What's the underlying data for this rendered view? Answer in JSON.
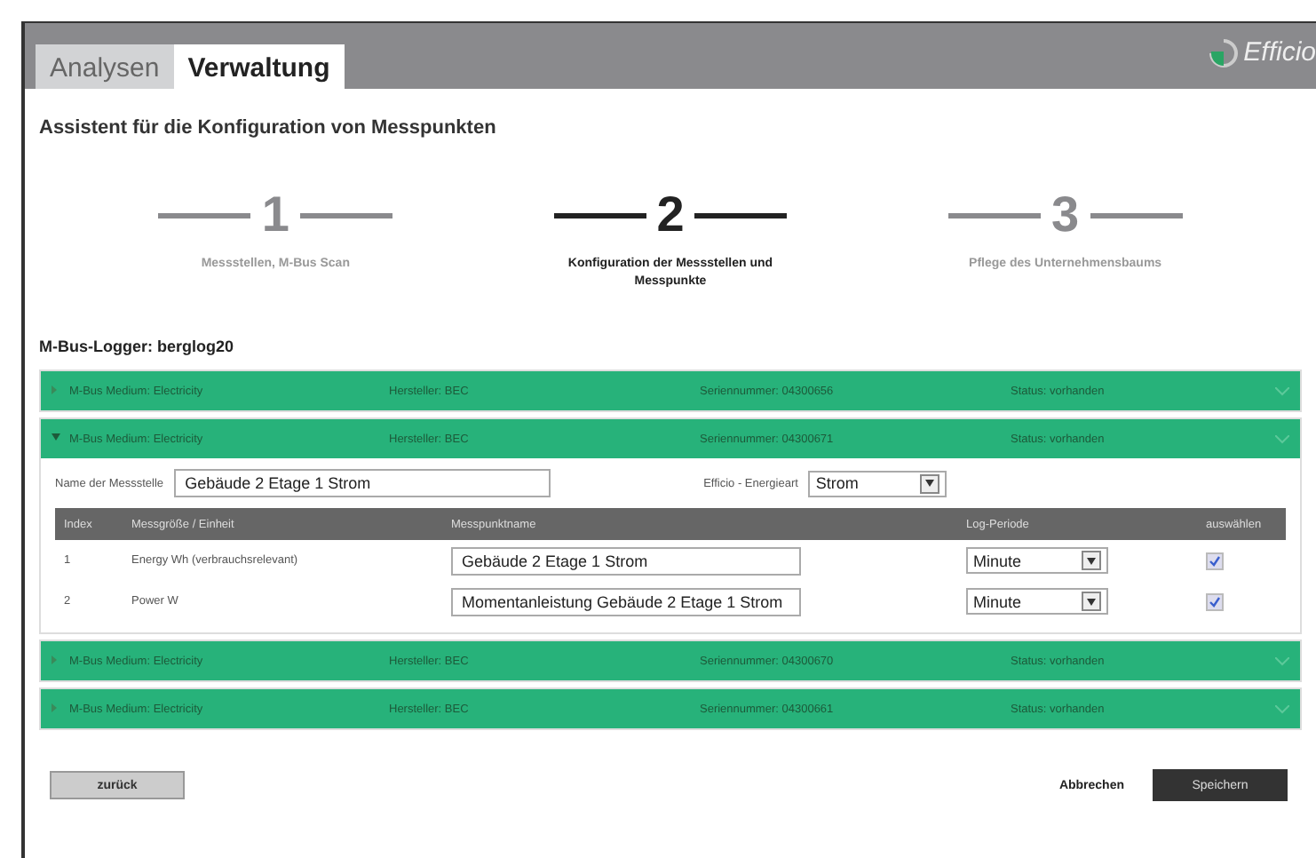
{
  "tabs": [
    {
      "label": "Analysen",
      "selected": false
    },
    {
      "label": "Verwaltung",
      "selected": true
    }
  ],
  "logo": {
    "text": "Efficio"
  },
  "title": "Assistent für die Konfiguration von Messpunkten",
  "steps": [
    {
      "number": "1",
      "label": "Messstellen, M-Bus Scan",
      "selected": false
    },
    {
      "number": "2",
      "label": "Konfiguration der Messstellen und Messpunkte",
      "selected": true
    },
    {
      "number": "3",
      "label": "Pflege des Unternehmensbaums",
      "selected": false
    }
  ],
  "logger": "M-Bus-Logger: berglog20",
  "devices": [
    {
      "medium": "M-Bus Medium: Electricity",
      "manufacturer": "Hersteller: BEC",
      "serial": "Seriennummer: 04300656",
      "status": "Status: vorhanden",
      "expanded": false
    },
    {
      "medium": "M-Bus Medium: Electricity",
      "manufacturer": "Hersteller: BEC",
      "serial": "Seriennummer: 04300671",
      "status": "Status: vorhanden",
      "expanded": true,
      "detail": {
        "name_label": "Name der Messstelle",
        "name_value": "Gebäude 2 Etage 1 Strom",
        "energy_label": "Efficio - Energieart",
        "energy_value": "Strom",
        "columns": [
          "Index",
          "Messgröße / Einheit",
          "Messpunktname",
          "Log-Periode",
          "auswählen"
        ],
        "rows": [
          {
            "index": "1",
            "quantity": "Energy Wh (verbrauchsrelevant)",
            "name": "Gebäude 2 Etage 1 Strom",
            "period": "Minute",
            "checked": true
          },
          {
            "index": "2",
            "quantity": "Power W",
            "name": "Momentanleistung Gebäude 2 Etage 1 Strom",
            "period": "Minute",
            "checked": true
          }
        ]
      }
    },
    {
      "medium": "M-Bus Medium: Electricity",
      "manufacturer": "Hersteller: BEC",
      "serial": "Seriennummer: 04300670",
      "status": "Status: vorhanden",
      "expanded": false
    },
    {
      "medium": "M-Bus Medium: Electricity",
      "manufacturer": "Hersteller: BEC",
      "serial": "Seriennummer: 04300661",
      "status": "Status: vorhanden",
      "expanded": false
    }
  ],
  "buttons": {
    "back": "zurück",
    "cancel": "Abbrechen",
    "save": "Speichern"
  }
}
